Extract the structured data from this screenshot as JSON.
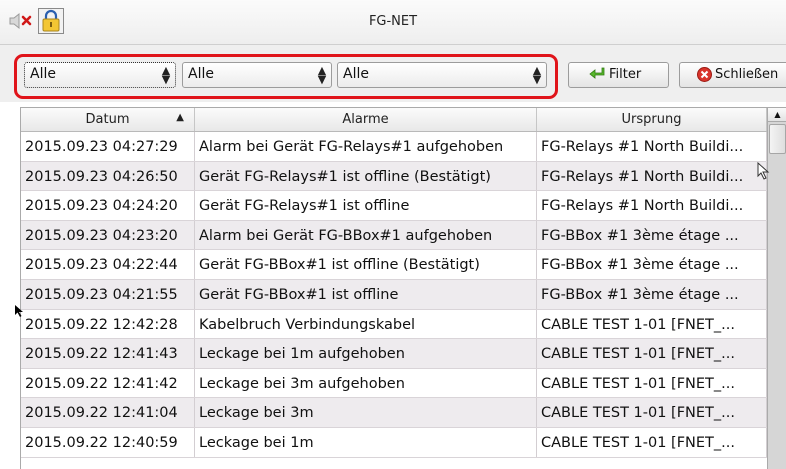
{
  "window": {
    "title": "FG-NET"
  },
  "toolbar": {
    "combo1": "Alle",
    "combo2": "Alle",
    "combo3": "Alle",
    "filter_label": "Filter",
    "close_label": "Schließen"
  },
  "table": {
    "headers": [
      "Datum",
      "Alarme",
      "Ursprung"
    ],
    "sort_indicator": "▲",
    "rows": [
      [
        "2015.09.23 04:27:29",
        "Alarm bei Gerät FG-Relays#1 aufgehoben",
        "FG-Relays #1 North Buildi..."
      ],
      [
        "2015.09.23 04:26:50",
        "Gerät FG-Relays#1 ist offline (Bestätigt)",
        "FG-Relays #1 North Buildi..."
      ],
      [
        "2015.09.23 04:24:20",
        "Gerät FG-Relays#1 ist offline",
        "FG-Relays #1 North Buildi..."
      ],
      [
        "2015.09.23 04:23:20",
        "Alarm bei Gerät FG-BBox#1 aufgehoben",
        "FG-BBox #1 3ème étage ..."
      ],
      [
        "2015.09.23 04:22:44",
        "Gerät FG-BBox#1 ist offline (Bestätigt)",
        "FG-BBox #1 3ème étage ..."
      ],
      [
        "2015.09.23 04:21:55",
        "Gerät FG-BBox#1 ist offline",
        "FG-BBox #1 3ème étage ..."
      ],
      [
        "2015.09.22 12:42:28",
        "Kabelbruch Verbindungskabel",
        "CABLE TEST 1-01 [FNET_..."
      ],
      [
        "2015.09.22 12:41:43",
        "Leckage bei 1m aufgehoben",
        "CABLE TEST 1-01 [FNET_..."
      ],
      [
        "2015.09.22 12:41:42",
        "Leckage bei 3m aufgehoben",
        "CABLE TEST 1-01 [FNET_..."
      ],
      [
        "2015.09.22 12:41:04",
        "Leckage bei 3m",
        "CABLE TEST 1-01 [FNET_..."
      ],
      [
        "2015.09.22 12:40:59",
        "Leckage bei 1m",
        "CABLE TEST 1-01 [FNET_..."
      ]
    ]
  },
  "icons": {
    "mute": "speaker-muted-icon",
    "lock": "padlock-icon",
    "filter": "green-arrow-icon",
    "close": "red-x-circle-icon"
  },
  "colors": {
    "highlight": "#e0141a",
    "row_alt": "#eeebee"
  }
}
